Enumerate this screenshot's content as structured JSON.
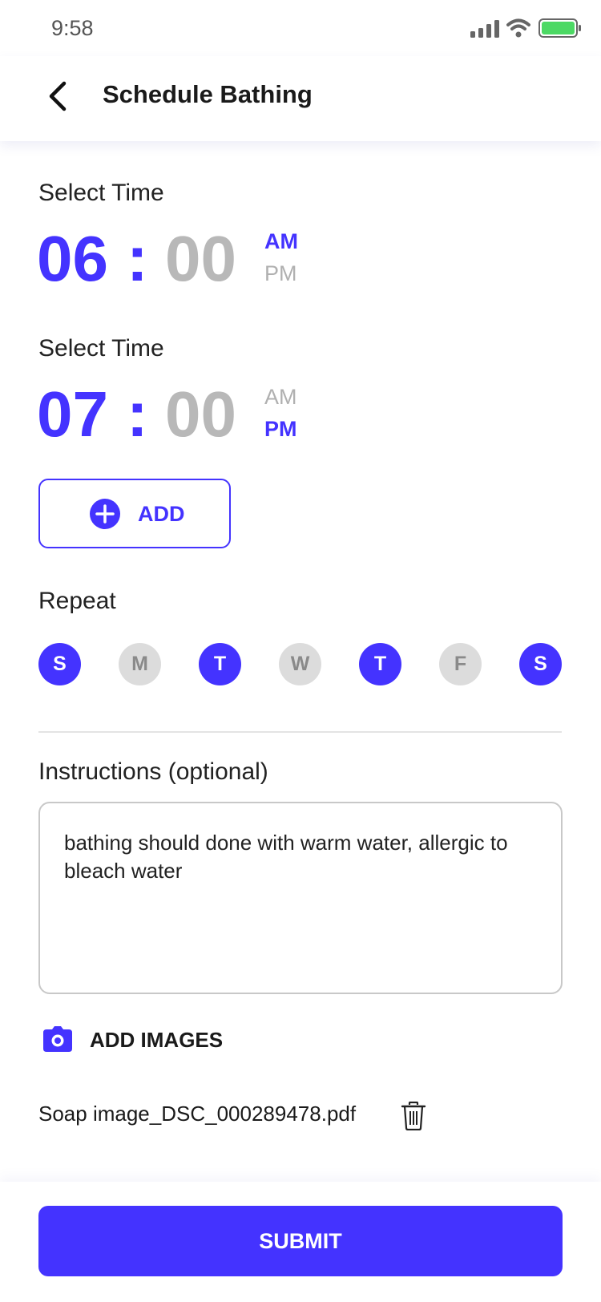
{
  "status_bar": {
    "time": "9:58",
    "battery_color": "#4cd964"
  },
  "header": {
    "title": "Schedule Bathing"
  },
  "time_slots": [
    {
      "label": "Select Time",
      "hour": "06",
      "separator": ":",
      "minute": "00",
      "am": "AM",
      "pm": "PM",
      "selected_period": "AM"
    },
    {
      "label": "Select Time",
      "hour": "07",
      "separator": ":",
      "minute": "00",
      "am": "AM",
      "pm": "PM",
      "selected_period": "PM"
    }
  ],
  "add_button": {
    "label": "ADD"
  },
  "repeat": {
    "label": "Repeat",
    "days": [
      {
        "letter": "S",
        "selected": true
      },
      {
        "letter": "M",
        "selected": false
      },
      {
        "letter": "T",
        "selected": true
      },
      {
        "letter": "W",
        "selected": false
      },
      {
        "letter": "T",
        "selected": true
      },
      {
        "letter": "F",
        "selected": false
      },
      {
        "letter": "S",
        "selected": true
      }
    ]
  },
  "instructions": {
    "label": "Instructions (optional)",
    "value": "bathing should done with warm water, allergic to bleach water"
  },
  "add_images": {
    "label": "ADD IMAGES"
  },
  "attachment": {
    "file_name": "Soap image_DSC_000289478.pdf"
  },
  "submit": {
    "label": "SUBMIT"
  },
  "colors": {
    "accent": "#4433ff",
    "inactive": "#b8b8b8",
    "day_off_bg": "#dcdcdc"
  }
}
